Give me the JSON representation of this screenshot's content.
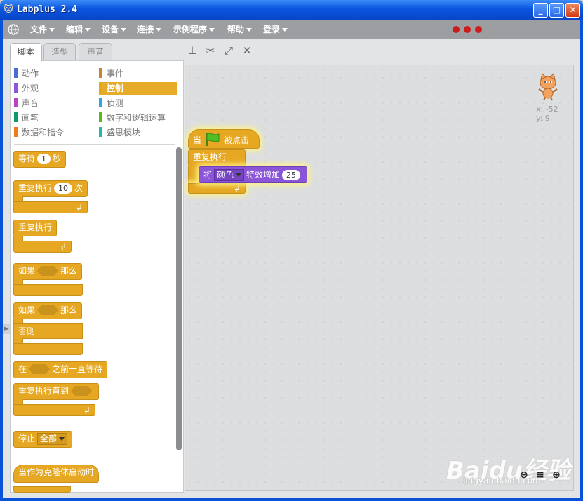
{
  "window": {
    "title": "Labplus 2.4",
    "min": "_",
    "max": "□",
    "close": "✕"
  },
  "menu": [
    "文件",
    "编辑",
    "设备",
    "连接",
    "示例程序",
    "帮助",
    "登录"
  ],
  "tabs": [
    "脚本",
    "造型",
    "声音"
  ],
  "categories": {
    "left": [
      {
        "label": "动作",
        "color": "#4a6cd4"
      },
      {
        "label": "外观",
        "color": "#8a55d7"
      },
      {
        "label": "声音",
        "color": "#bb42c3"
      },
      {
        "label": "画笔",
        "color": "#0e9a6c"
      },
      {
        "label": "数据和指令",
        "color": "#ee7d16"
      }
    ],
    "right": [
      {
        "label": "事件",
        "color": "#c88330"
      },
      {
        "label": "控制",
        "color": "#e1a91a"
      },
      {
        "label": "侦测",
        "color": "#2ca5e2"
      },
      {
        "label": "数字和逻辑运算",
        "color": "#5cb712"
      },
      {
        "label": "盛思模块",
        "color": "#20b9ab"
      }
    ]
  },
  "palette": {
    "wait": {
      "label": "等待",
      "value": "1",
      "unit": "秒"
    },
    "repeat": {
      "label": "重复执行",
      "value": "10",
      "unit": "次"
    },
    "forever": {
      "label": "重复执行"
    },
    "if": {
      "label": "如果",
      "then": "那么"
    },
    "ifelse": {
      "label": "如果",
      "then": "那么",
      "else": "否则"
    },
    "wait_until": {
      "label": "在",
      "after": "之前一直等待"
    },
    "repeat_until": {
      "label": "重复执行直到"
    },
    "stop": {
      "label": "停止",
      "option": "全部"
    },
    "clone": {
      "label": "当作为克隆体启动时"
    }
  },
  "script": {
    "hat": {
      "prefix": "当",
      "suffix": "被点击"
    },
    "forever": "重复执行",
    "effect": {
      "prefix": "将",
      "effect": "颜色",
      "middle": "特效增加",
      "value": "25"
    }
  },
  "sprite": {
    "x": "x: -52",
    "y": "y: 9"
  },
  "watermark": {
    "brand": "Baidu经验",
    "url": "jingyan.baidu.com"
  },
  "colors": {
    "control": "#e6a822",
    "looks": "#8a55d7",
    "titlebar": "#0a55e0"
  }
}
